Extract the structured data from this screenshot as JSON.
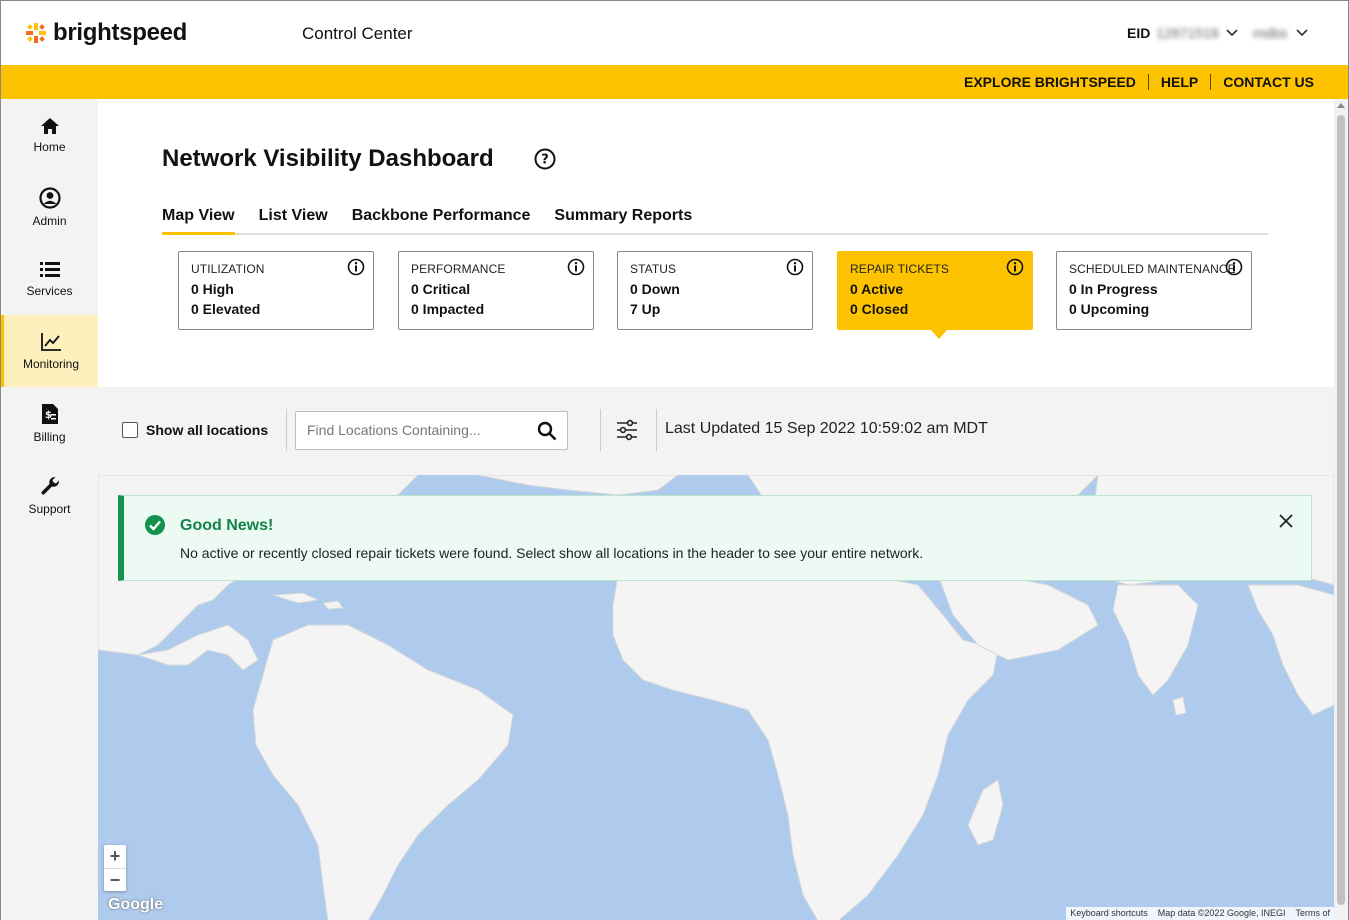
{
  "header": {
    "brand": "brightspeed",
    "app_title": "Control Center",
    "eid_label": "EID",
    "eid_value": "12871518",
    "user_name": "mdbs",
    "links": [
      "EXPLORE BRIGHTSPEED",
      "HELP",
      "CONTACT US"
    ]
  },
  "sidebar": {
    "items": [
      {
        "label": "Home",
        "icon": "home-icon"
      },
      {
        "label": "Admin",
        "icon": "user-circle-icon"
      },
      {
        "label": "Services",
        "icon": "list-icon"
      },
      {
        "label": "Monitoring",
        "icon": "line-chart-icon",
        "active": true
      },
      {
        "label": "Billing",
        "icon": "invoice-icon"
      },
      {
        "label": "Support",
        "icon": "wrench-icon"
      }
    ]
  },
  "page": {
    "title": "Network Visibility Dashboard",
    "tabs": [
      "Map View",
      "List View",
      "Backbone Performance",
      "Summary Reports"
    ],
    "active_tab": "Map View"
  },
  "cards": [
    {
      "title": "UTILIZATION",
      "line1": "0 High",
      "line2": "0 Elevated"
    },
    {
      "title": "PERFORMANCE",
      "line1": "0 Critical",
      "line2": "0 Impacted"
    },
    {
      "title": "STATUS",
      "line1": "0 Down",
      "line2": "7 Up"
    },
    {
      "title": "REPAIR TICKETS",
      "line1": "0 Active",
      "line2": "0 Closed",
      "selected": true
    },
    {
      "title": "SCHEDULED MAINTENANCE",
      "line1": "0 In Progress",
      "line2": "0 Upcoming"
    }
  ],
  "filters": {
    "show_all_label": "Show all locations",
    "show_all_checked": false,
    "search_placeholder": "Find Locations Containing...",
    "last_updated": "Last Updated 15 Sep 2022 10:59:02 am MDT"
  },
  "banner": {
    "title": "Good News!",
    "message": "No active or recently closed repair tickets were found. Select show all locations in the header to see your entire network."
  },
  "map": {
    "zoom_in": "+",
    "zoom_out": "−",
    "google": "Google",
    "attribution": [
      "Keyboard shortcuts",
      "Map data ©2022 Google, INEGI",
      "Terms of"
    ]
  },
  "colors": {
    "brand_yellow": "#fdc300",
    "success_green": "#12924d",
    "ocean": "#aecbed",
    "land": "#f4f4f4"
  }
}
